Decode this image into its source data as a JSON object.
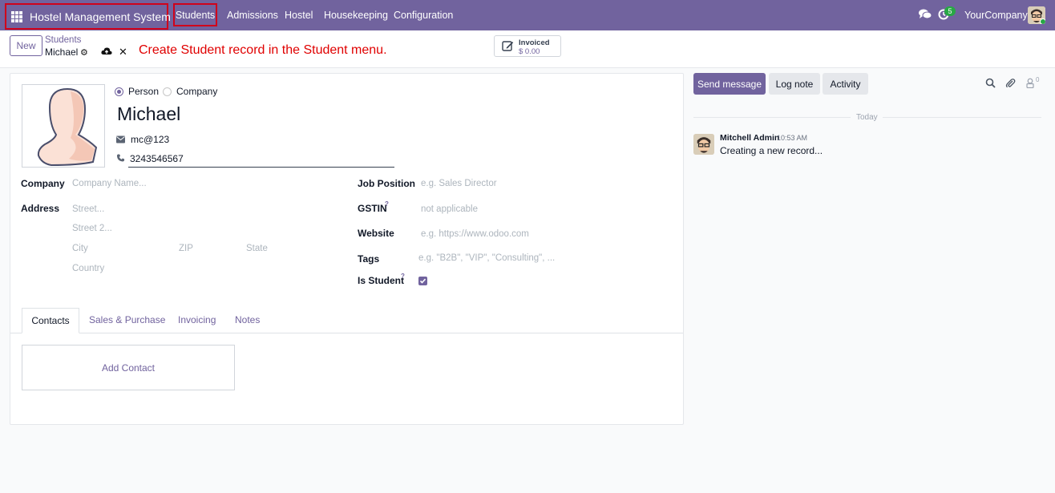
{
  "navbar": {
    "app_name": "Hostel Management System",
    "menus": [
      "Students",
      "Admissions",
      "Hostel",
      "Housekeeping",
      "Configuration"
    ],
    "activity_count": "5",
    "company": "YourCompany",
    "color": "#71639e"
  },
  "control": {
    "new_label": "New",
    "breadcrumb_parent": "Students",
    "breadcrumb_current": "Michael",
    "instruction": "Create Student record in the Student menu.",
    "invoiced_label": "Invoiced",
    "invoiced_value": "$ 0.00"
  },
  "form": {
    "type_person": "Person",
    "type_company": "Company",
    "name": "Michael",
    "email": "mc@123",
    "phone": "3243546567",
    "company_label": "Company",
    "company_placeholder": "Company Name...",
    "address_label": "Address",
    "street_placeholder": "Street...",
    "street2_placeholder": "Street 2...",
    "city_placeholder": "City",
    "zip_placeholder": "ZIP",
    "state_placeholder": "State",
    "country_placeholder": "Country",
    "job_label": "Job Position",
    "job_placeholder": "e.g. Sales Director",
    "gstin_label": "GSTIN",
    "gstin_placeholder": "not applicable",
    "website_label": "Website",
    "website_placeholder": "e.g. https://www.odoo.com",
    "tags_label": "Tags",
    "tags_placeholder": "e.g. \"B2B\", \"VIP\", \"Consulting\", ...",
    "is_student_label": "Is Student",
    "is_student": true,
    "help_mark": "?"
  },
  "tabs": [
    "Contacts",
    "Sales & Purchase",
    "Invoicing",
    "Notes"
  ],
  "add_contact": "Add Contact",
  "chatter": {
    "send_message": "Send message",
    "log_note": "Log note",
    "activity": "Activity",
    "followers_count": "0",
    "date_separator": "Today",
    "message": {
      "author": "Mitchell Admin",
      "time": "10:53 AM",
      "body": "Creating a new record..."
    }
  }
}
